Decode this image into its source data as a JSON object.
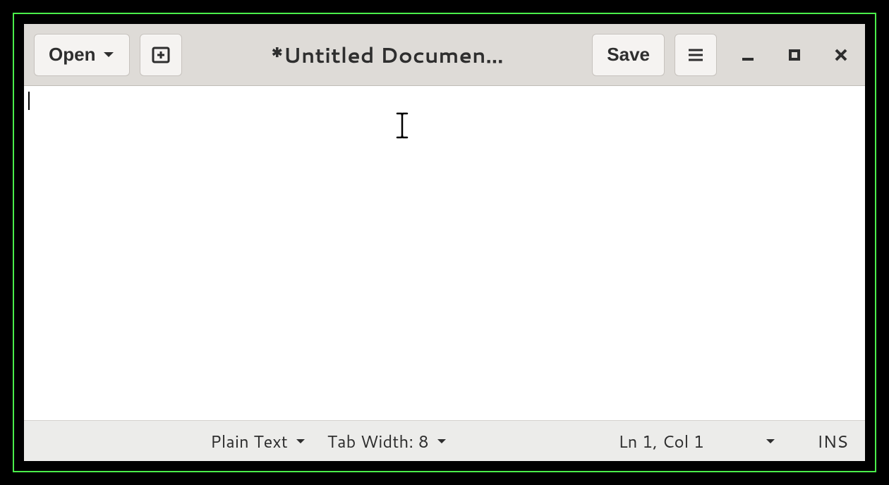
{
  "header": {
    "open_label": "Open",
    "title": "*Untitled Documen…",
    "save_label": "Save"
  },
  "editor": {
    "content": ""
  },
  "statusbar": {
    "syntax": "Plain Text",
    "tab_width": "Tab Width: 8",
    "position": "Ln 1, Col 1",
    "insert_mode": "INS"
  }
}
